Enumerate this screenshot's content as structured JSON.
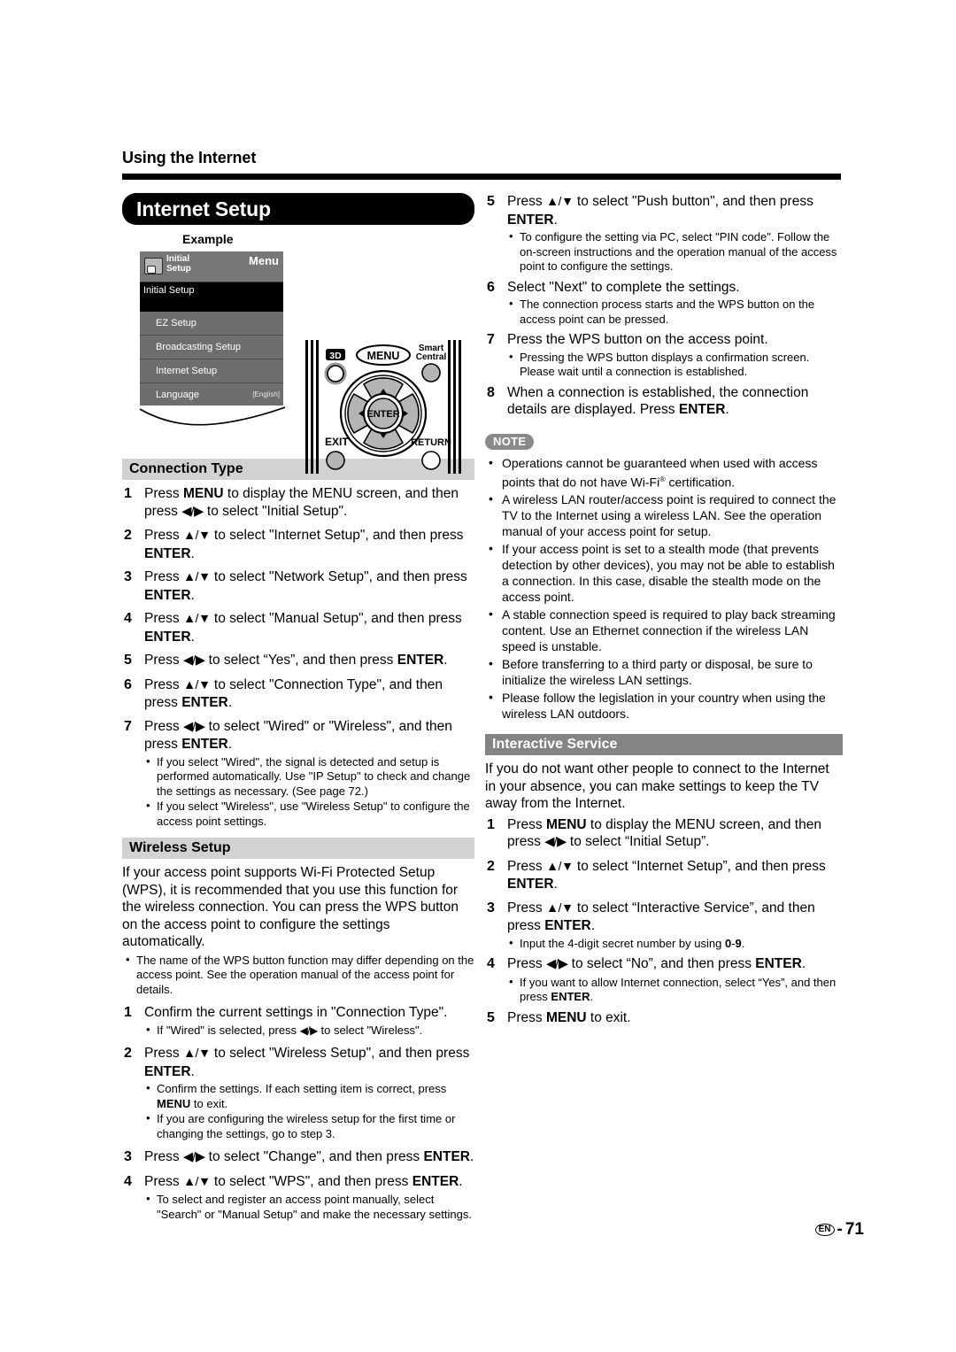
{
  "page": {
    "running_head": "Using the Internet",
    "title": "Internet Setup",
    "footer_lang": "EN",
    "footer_sep": "-",
    "footer_page": "71",
    "colors": {
      "banner": "#000000",
      "sec_bar_light": "#d2d2d2",
      "sec_bar_dark": "#848484",
      "note_badge": "#8a8a8a"
    }
  },
  "example": {
    "label": "Example",
    "menu": {
      "icon_title_line1": "Initial",
      "icon_title_line2": "Setup",
      "menu_label": "Menu",
      "section_title": "Initial Setup",
      "rows": [
        {
          "label": "EZ Setup",
          "value": ""
        },
        {
          "label": "Broadcasting Setup",
          "value": ""
        },
        {
          "label": "Internet Setup",
          "value": ""
        },
        {
          "label": "Language",
          "value": "[English]"
        }
      ]
    },
    "remote": {
      "btn_3d": "3D",
      "btn_menu": "MENU",
      "btn_smart_line1": "Smart",
      "btn_smart_line2": "Central",
      "btn_enter": "ENTER",
      "btn_exit": "EXIT",
      "btn_return": "RETURN"
    }
  },
  "connection_type": {
    "heading": "Connection Type",
    "steps": [
      {
        "num": "1",
        "html": "Press <b>MENU</b> to display the MENU screen, and then press <span class=\"arrowglyph\">◀/▶</span> to select \"Initial Setup\"."
      },
      {
        "num": "2",
        "html": "Press <span class=\"arrowglyph\">▲/▼</span> to select \"Internet Setup\", and then press <b>ENTER</b>."
      },
      {
        "num": "3",
        "html": "Press <span class=\"arrowglyph\">▲/▼</span> to select \"Network Setup\", and then press <b>ENTER</b>."
      },
      {
        "num": "4",
        "html": "Press <span class=\"arrowglyph\">▲/▼</span> to select \"Manual Setup\", and then press <b>ENTER</b>."
      },
      {
        "num": "5",
        "html": "Press <span class=\"arrowglyph\">◀/▶</span> to select “Yes”, and then press <b>ENTER</b>."
      },
      {
        "num": "6",
        "html": "Press <span class=\"arrowglyph\">▲/▼</span> to select \"Connection Type\", and then press <b>ENTER</b>."
      },
      {
        "num": "7",
        "html": "Press <span class=\"arrowglyph\">◀/▶</span> to select \"Wired\" or \"Wireless\", and then press <b>ENTER</b>."
      }
    ],
    "step7_bullets": [
      "If you select \"Wired\", the signal is detected and setup is performed automatically. Use \"IP Setup\" to check and change the settings as necessary. (See page 72.)",
      "If you select \"Wireless\", use \"Wireless Setup\" to configure the access point settings."
    ]
  },
  "wireless_setup": {
    "heading": "Wireless Setup",
    "intro": "If your access point supports Wi-Fi Protected Setup (WPS), it is recommended that you use this function for the wireless connection. You can press the WPS button on the access point to configure the settings automatically.",
    "intro_bullets": [
      "The name of the WPS button function may differ depending on the access point. See the operation manual of the access point for details."
    ],
    "steps": [
      {
        "num": "1",
        "html": "Confirm the current settings in \"Connection Type\"."
      },
      {
        "num": "2",
        "html": "Press <span class=\"arrowglyph\">▲/▼</span> to select \"Wireless Setup\", and then press <b>ENTER</b>."
      },
      {
        "num": "3",
        "html": "Press <span class=\"arrowglyph\">◀/▶</span> to select \"Change\", and then press <b>ENTER</b>."
      },
      {
        "num": "4",
        "html": "Press <span class=\"arrowglyph\">▲/▼</span> to select \"WPS\", and then press <b>ENTER</b>."
      },
      {
        "num": "5",
        "html": "Press <span class=\"arrowglyph\">▲/▼</span> to select \"Push button\", and then press <b>ENTER</b>."
      },
      {
        "num": "6",
        "html": "Select \"Next\" to complete the settings."
      },
      {
        "num": "7",
        "html": "Press the WPS button on the access point."
      },
      {
        "num": "8",
        "html": "When a connection is established, the connection details are displayed. Press <b>ENTER</b>."
      }
    ],
    "step1_bullets": [
      "If \"Wired\" is selected, press <span class=\"arrowglyph\">◀/▶</span> to select \"Wireless\"."
    ],
    "step2_bullets": [
      "Confirm the settings. If each setting item is correct, press <b>MENU</b> to exit.",
      "If you are configuring the wireless setup for the first time or changing the settings, go to step 3."
    ],
    "step4_bullets": [
      "To select and register an access point manually, select \"Search\" or \"Manual Setup\" and make the necessary settings."
    ],
    "step5_bullets": [
      "To configure the setting via PC, select \"PIN code\". Follow the on-screen instructions and the operation manual of the access point to configure the settings."
    ],
    "step6_bullets": [
      "The connection process starts and the WPS button on the access point can be pressed."
    ],
    "step7_bullets": [
      "Pressing the WPS button displays a confirmation screen. Please wait until a connection is established."
    ]
  },
  "note": {
    "badge": "NOTE",
    "bullets": [
      "Operations cannot be guaranteed when used with access points that do not have Wi-Fi<span class=\"sup\">®</span> certification.",
      "A wireless LAN router/access point is required to connect the TV to the Internet using a wireless LAN. See the operation manual of your access point for setup.",
      "If your access point is set to a stealth mode (that prevents detection by other devices), you may not be able to establish a connection. In this case, disable the stealth mode on the access point.",
      "A stable connection speed is required to play back streaming content. Use an Ethernet connection if the wireless LAN speed is unstable.",
      "Before transferring to a third party or disposal, be sure to initialize the wireless LAN settings.",
      "Please follow the legislation in your country when using the wireless LAN outdoors."
    ]
  },
  "interactive_service": {
    "heading": "Interactive Service",
    "intro": "If you do not want other people to connect to the Internet in your absence, you can make settings to keep the TV away from the Internet.",
    "steps": [
      {
        "num": "1",
        "html": "Press <b>MENU</b> to display the MENU screen, and then press <span class=\"arrowglyph\">◀/▶</span> to select “Initial Setup”."
      },
      {
        "num": "2",
        "html": "Press <span class=\"arrowglyph\">▲/▼</span> to select “Internet Setup”, and then press <b>ENTER</b>."
      },
      {
        "num": "3",
        "html": "Press <span class=\"arrowglyph\">▲/▼</span> to select “Interactive Service”, and then press <b>ENTER</b>."
      },
      {
        "num": "4",
        "html": "Press <span class=\"arrowglyph\">◀/▶</span> to select “No”, and then press <b>ENTER</b>."
      },
      {
        "num": "5",
        "html": "Press <b>MENU</b> to exit."
      }
    ],
    "step3_bullets": [
      "Input the 4-digit secret number by using <b>0</b>-<b>9</b>."
    ],
    "step4_bullets": [
      "If you want to allow Internet connection, select “Yes”, and then press <b>ENTER</b>."
    ]
  }
}
